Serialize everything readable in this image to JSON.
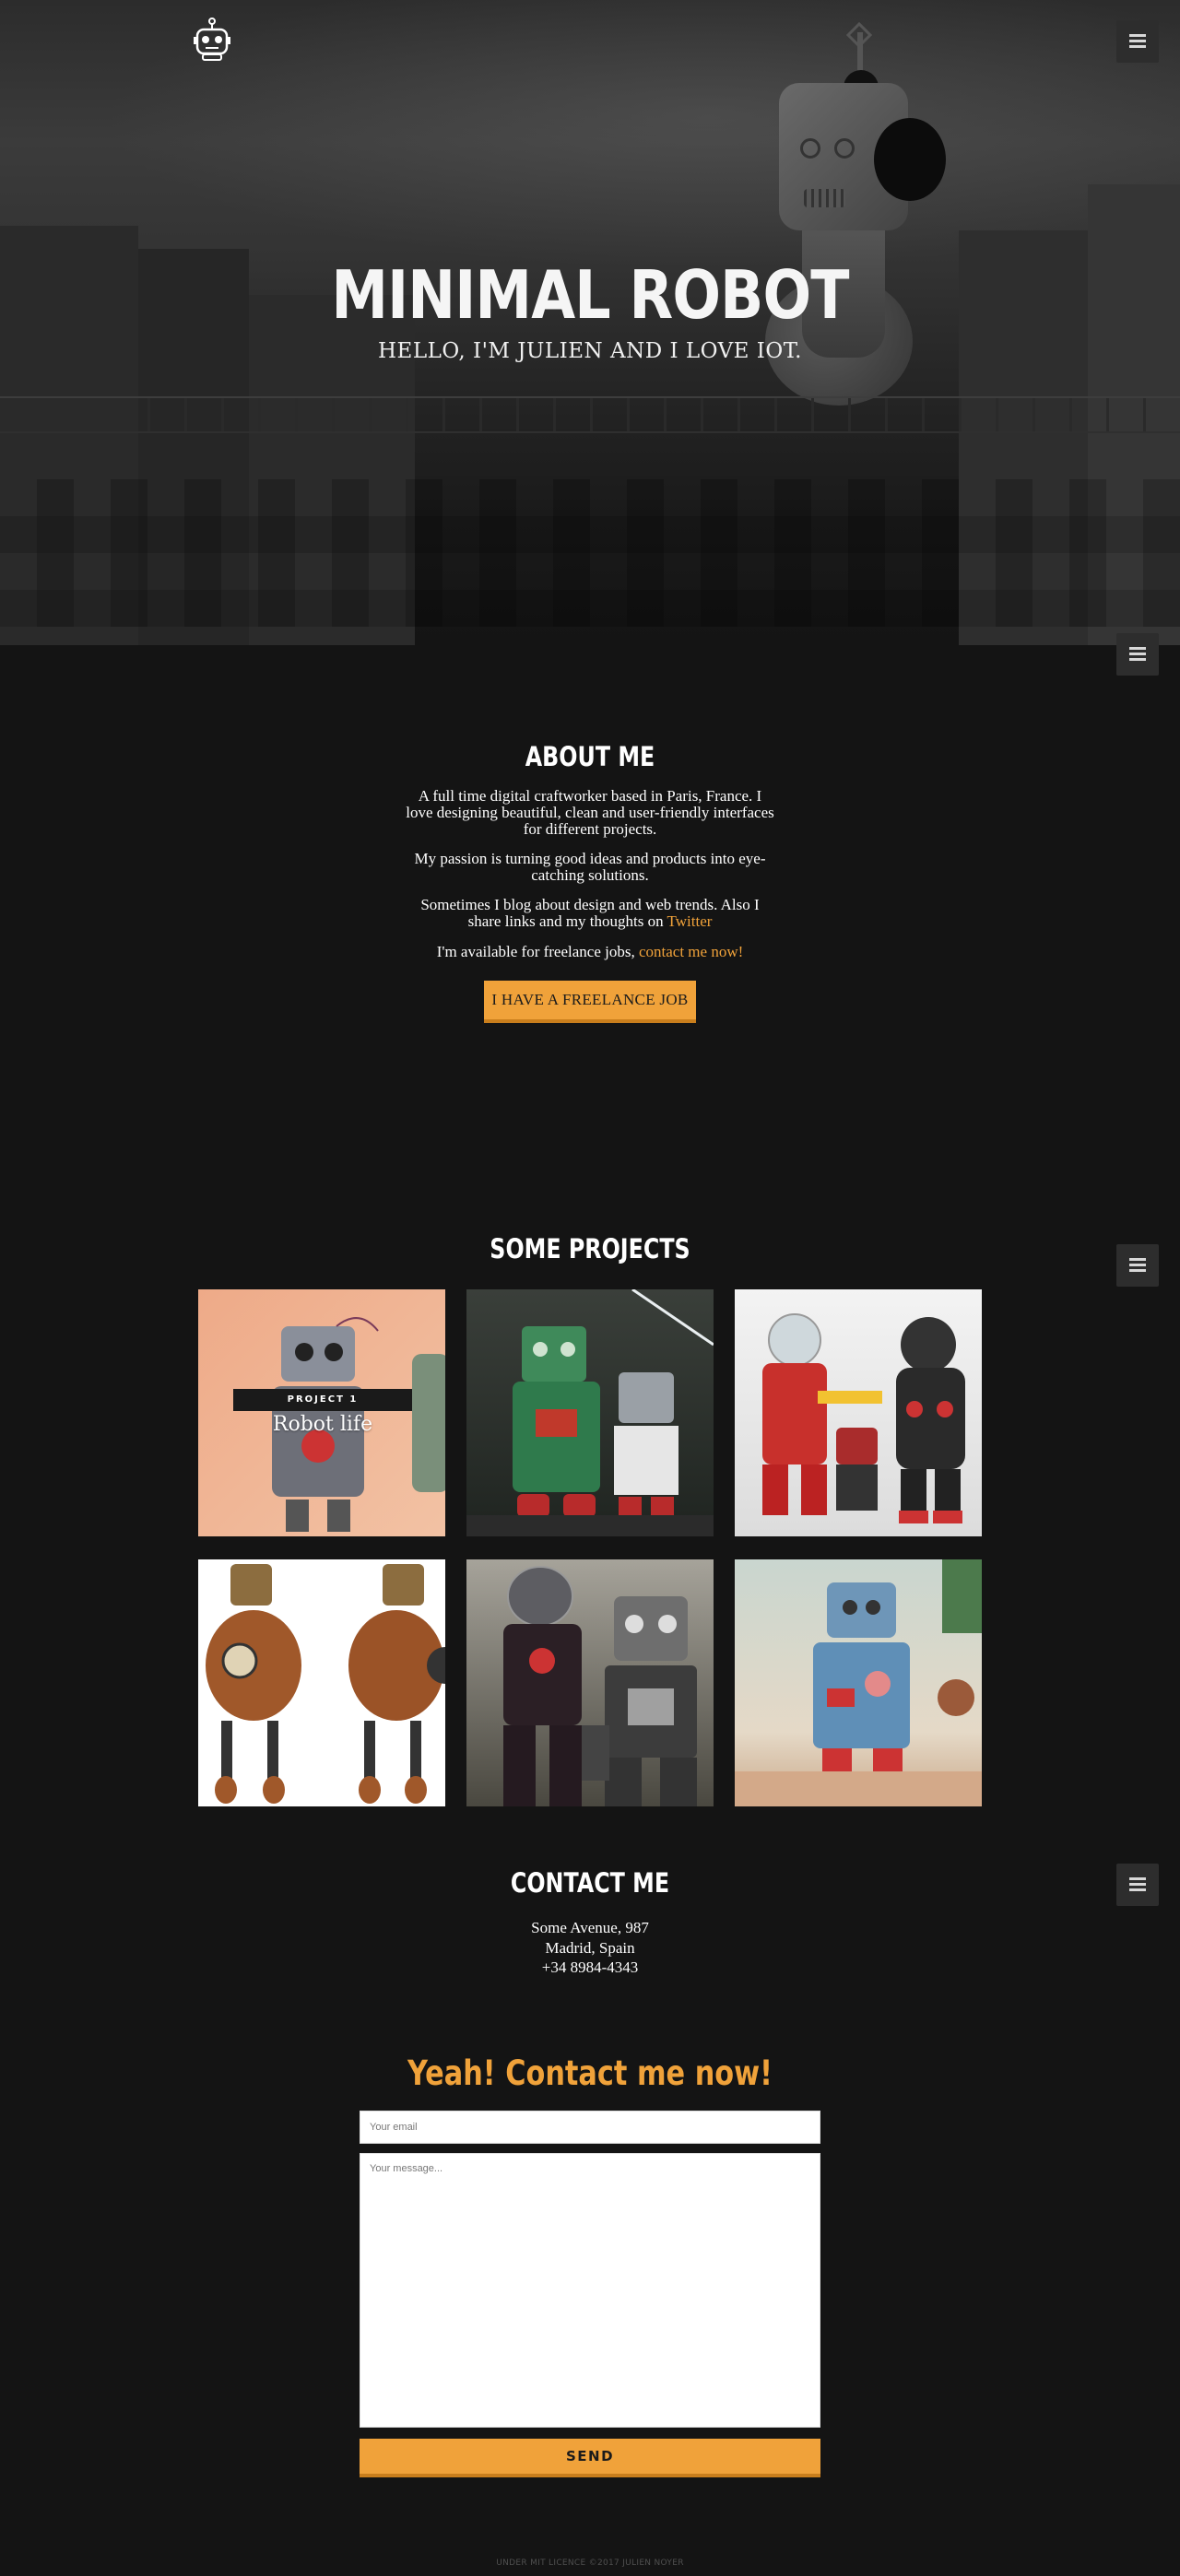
{
  "hero": {
    "title": "MINIMAL ROBOT",
    "subtitle": "HELLO, I'M JULIEN AND I LOVE IOT."
  },
  "icons": {
    "logo": "robot-logo-icon",
    "menu": "hamburger-menu-icon"
  },
  "about": {
    "title": "ABOUT ME",
    "p1": "A full time digital craftworker based in Paris, France. I love designing beautiful, clean and user-friendly interfaces for different projects.",
    "p2": "My passion is turning good ideas and products into eye-catching solutions.",
    "p3": "Sometimes I blog about design and web trends. Also I share links and my thoughts on ",
    "p3_link": "Twitter",
    "p4": "I'm available for freelance jobs, ",
    "p4_link": "contact me now!",
    "cta": "I HAVE A FREELANCE JOB"
  },
  "projects": {
    "title": "SOME PROJECTS",
    "featured": {
      "tag": "PROJECT 1",
      "name": "Robot life"
    }
  },
  "contact": {
    "title": "CONTACT ME",
    "address1": "Some Avenue, 987",
    "address2": "Madrid, Spain",
    "phone": "+34 8984-4343"
  },
  "form": {
    "title": "Yeah! Contact me now!",
    "email_placeholder": "Your email",
    "message_placeholder": "Your message...",
    "send": "SEND"
  },
  "footer": {
    "text": "UNDER MIT LICENCE ©2017 JULIEN NOYER"
  },
  "colors": {
    "accent": "#f0a23a",
    "background": "#141414"
  }
}
